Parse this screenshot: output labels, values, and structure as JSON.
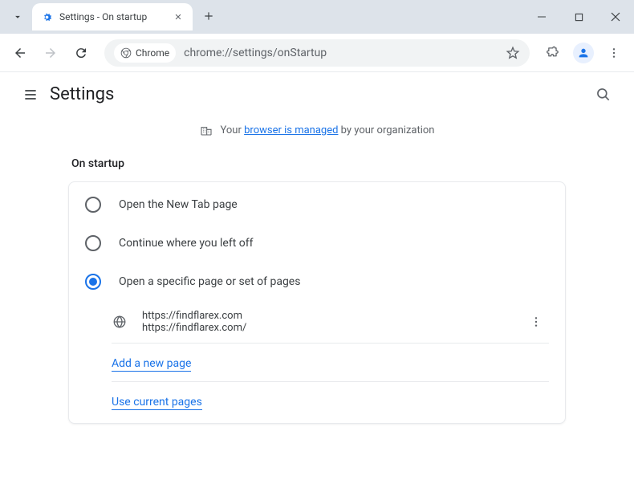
{
  "titlebar": {
    "tab_title": "Settings - On startup"
  },
  "toolbar": {
    "chrome_label": "Chrome",
    "url": "chrome://settings/onStartup"
  },
  "header": {
    "title": "Settings"
  },
  "banner": {
    "prefix": "Your ",
    "link": "browser is managed",
    "suffix": " by your organization"
  },
  "section": {
    "title": "On startup",
    "options": [
      {
        "label": "Open the New Tab page"
      },
      {
        "label": "Continue where you left off"
      },
      {
        "label": "Open a specific page or set of pages"
      }
    ],
    "page": {
      "title": "https://findflarex.com",
      "url": "https://findflarex.com/"
    },
    "add_link": "Add a new page",
    "use_current": "Use current pages"
  }
}
